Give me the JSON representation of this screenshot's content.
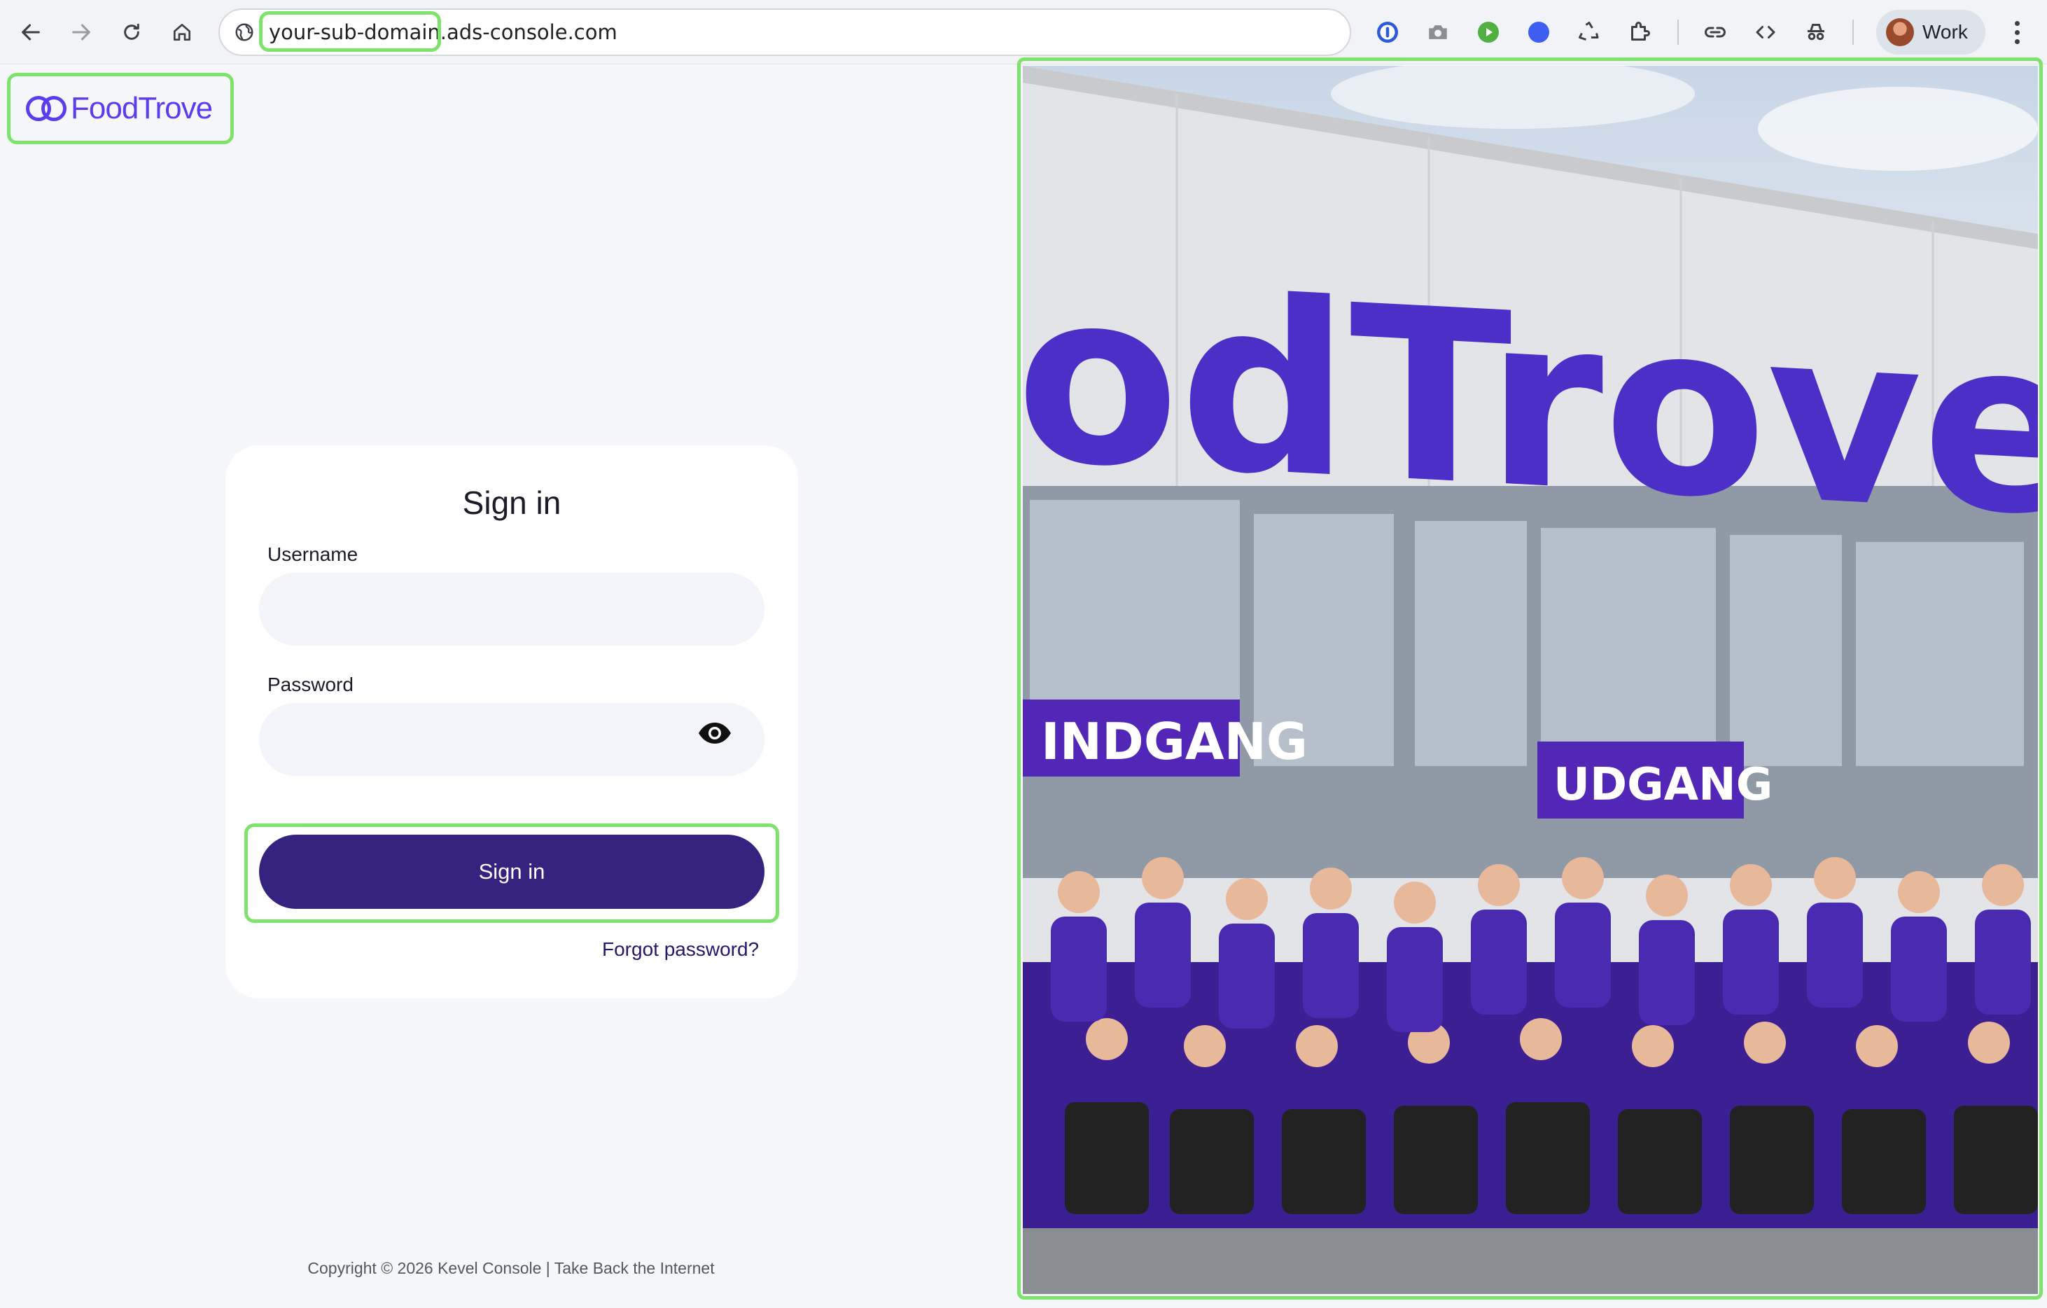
{
  "browser": {
    "url": "your-sub-domain.ads-console.com",
    "profile_label": "Work"
  },
  "brand": {
    "logo_text": "FoodTrove",
    "color": "#5b3df0"
  },
  "signin_card": {
    "title": "Sign in",
    "username_label": "Username",
    "username_value": "",
    "password_label": "Password",
    "password_value": "",
    "submit_label": "Sign in",
    "forgot_label": "Forgot password?"
  },
  "footer": {
    "copyright": "Copyright © 2026 Kevel Console | Take Back the Internet"
  },
  "hero_image": {
    "sign_text": "odTrove",
    "left_banner": "INDGANG",
    "right_banner": "UDGANG"
  },
  "colors": {
    "primary_button": "#35237f",
    "highlight": "#7ee36b",
    "link": "#26166e"
  }
}
